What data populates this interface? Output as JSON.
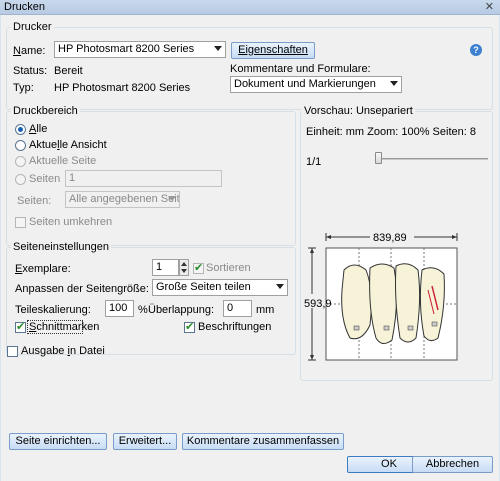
{
  "window": {
    "title": "Drucken",
    "close_glyph": "✕"
  },
  "printer": {
    "group_title": "Drucker",
    "name_label": "Name:",
    "name_value": "HP Photosmart 8200 Series",
    "properties_button": "Eigenschaften",
    "status_label": "Status:",
    "status_value": "Bereit",
    "type_label": "Typ:",
    "type_value": "HP Photosmart 8200 Series",
    "comments_label": "Kommentare und Formulare:",
    "comments_value": "Dokument und Markierungen",
    "help_glyph": "?"
  },
  "range": {
    "group_title": "Druckbereich",
    "all": "Alle",
    "current_view": "Aktuelle Ansicht",
    "current_page": "Aktuelle Seite",
    "pages": "Seiten",
    "pages_value": "1",
    "subset_label": "Seiten:",
    "subset_value": "Alle angegebenen Seiten",
    "reverse": "Seiten umkehren"
  },
  "page_settings": {
    "group_title": "Seiteneinstellungen",
    "copies_label": "Exemplare:",
    "copies_value": "1",
    "collate": "Sortieren",
    "scaling_label": "Anpassen der Seitengröße:",
    "scaling_value": "Große Seiten teilen",
    "tile_scale_label": "Teileskalierung:",
    "tile_scale_value": "100",
    "percent": "%",
    "overlap_label": "Überlappung:",
    "overlap_value": "0",
    "overlap_unit": "mm",
    "cut_marks": "Schnittmarken",
    "labels": "Beschriftungen"
  },
  "print_to_file": "Ausgabe in Datei",
  "preview": {
    "title": "Vorschau: Unsepariert",
    "info": "Einheit: mm Zoom: 100% Seiten: 8",
    "page_indicator": "1/1",
    "width_label": "839,89",
    "height_label": "593,9"
  },
  "footer": {
    "page_setup": "Seite einrichten...",
    "advanced": "Erweitert...",
    "summarize": "Kommentare zusammenfassen",
    "ok": "OK",
    "cancel": "Abbrechen"
  }
}
